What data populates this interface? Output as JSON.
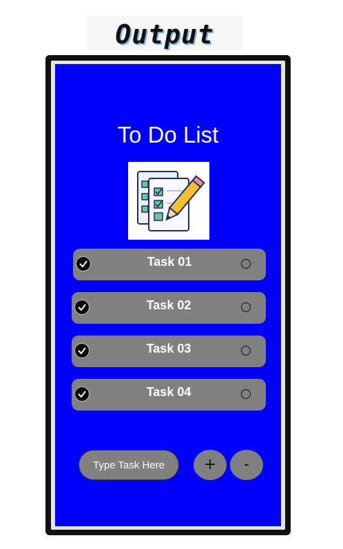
{
  "heading": "Output",
  "app": {
    "title": "To Do List",
    "tasks": [
      {
        "label": "Task 01"
      },
      {
        "label": "Task 02"
      },
      {
        "label": "Task 03"
      },
      {
        "label": "Task 04"
      }
    ],
    "input_placeholder": "Type Task Here",
    "add_label": "+",
    "remove_label": "-"
  },
  "colors": {
    "screen_bg": "#0000fe",
    "item_bg": "#808080",
    "heading_shadow": "#7fb2e5"
  },
  "icons": {
    "logo": "checklist-with-pencil-icon",
    "task_check": "check-circle-icon",
    "task_radio": "radio-circle-icon"
  }
}
